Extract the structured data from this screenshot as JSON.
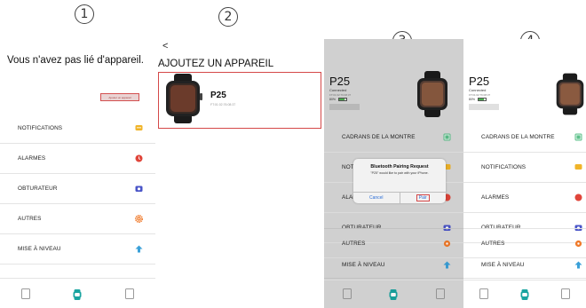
{
  "steps": [
    "1",
    "2",
    "3",
    "4"
  ],
  "panel1": {
    "empty_title": "Vous n'avez pas lié d'appareil.",
    "add_button": "Ajouter un appareil",
    "menu": [
      "NOTIFICATIONS",
      "ALARMES",
      "OBTURATEUR",
      "AUTRES",
      "MISE À NIVEAU"
    ]
  },
  "panel2": {
    "back": "<",
    "title": "AJOUTEZ UN APPAREIL",
    "device_name": "P25",
    "device_mac": "FT:01:02:76:08:37"
  },
  "panel3": {
    "device_name": "P25",
    "status": "Connected",
    "mac": "FT:01:02:76:08:37",
    "battery": "80%",
    "battery_level": 0.8,
    "menu": [
      "CADRANS DE LA MONTRE",
      "NOTIFICATIONS",
      "ALARMES",
      "OBTURATEUR",
      "AUTRES",
      "MISE À NIVEAU"
    ],
    "dialog": {
      "title": "Bluetooth Pairing Request",
      "message": "\"P25\" would like to pair with your iPhone.",
      "cancel": "Cancel",
      "pair": "Pair"
    }
  },
  "panel4": {
    "device_name": "P25",
    "status": "Connected",
    "mac": "FT:01:02:76:08:37",
    "battery": "80%",
    "battery_level": 0.8,
    "menu": [
      "CADRANS DE LA MONTRE",
      "NOTIFICATIONS",
      "ALARMES",
      "OBTURATEUR",
      "AUTRES",
      "MISE À NIVEAU"
    ]
  },
  "colors": {
    "accent_red": "#d54848",
    "notify": "#f0b429",
    "alarm": "#e0453a",
    "shutter": "#4a55c8",
    "other": "#f07a2a",
    "upgrade": "#3aa0d8",
    "watch_faces": "#5cc08a",
    "tab_active": "#19a4a0"
  }
}
